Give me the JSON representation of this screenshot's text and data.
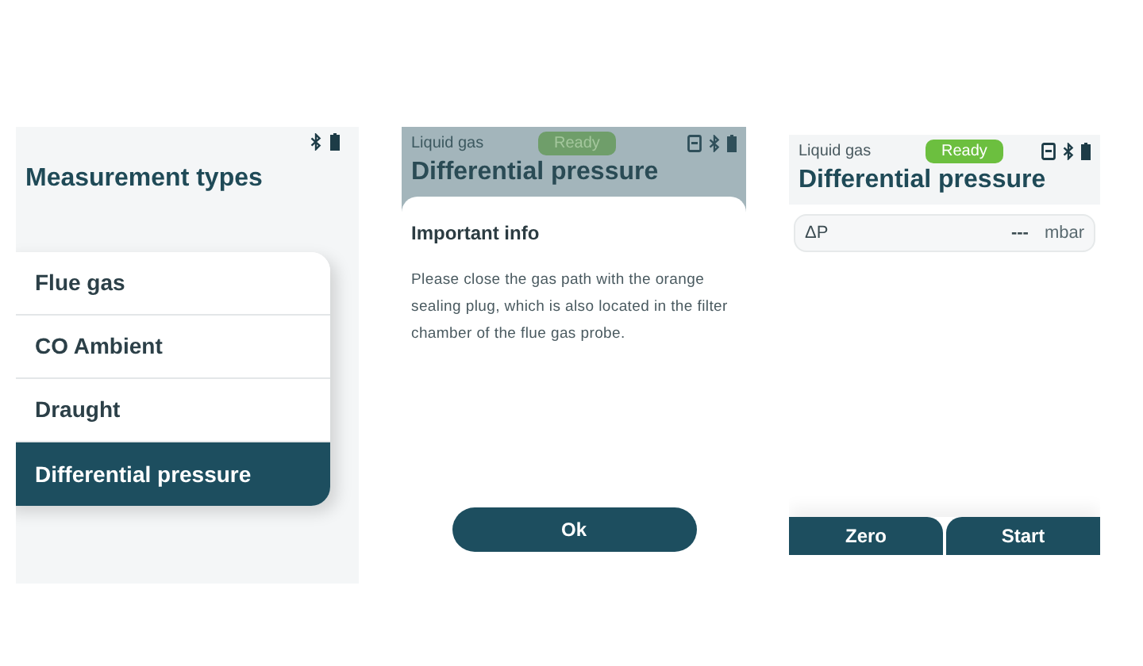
{
  "screens": [
    {
      "kind": "menu",
      "title": "Measurement types",
      "items": [
        {
          "label": "Flue gas",
          "selected": false
        },
        {
          "label": "CO Ambient",
          "selected": false
        },
        {
          "label": "Draught",
          "selected": false
        },
        {
          "label": "Differential pressure",
          "selected": true
        }
      ]
    },
    {
      "kind": "dialog",
      "header": {
        "profile": "Liquid gas",
        "status": "Ready",
        "title": "Differential pressure"
      },
      "dialog": {
        "title": "Important info",
        "message": "Please close the gas path with the orange sealing plug, which is also located in the filter chamber of the flue gas probe.",
        "button": "Ok"
      }
    },
    {
      "kind": "measure",
      "header": {
        "profile": "Liquid gas",
        "status": "Ready",
        "title": "Differential pressure"
      },
      "readings": [
        {
          "symbol": "ΔP",
          "value": "---",
          "unit": "mbar"
        }
      ],
      "buttons": [
        "Zero",
        "Start"
      ]
    }
  ]
}
